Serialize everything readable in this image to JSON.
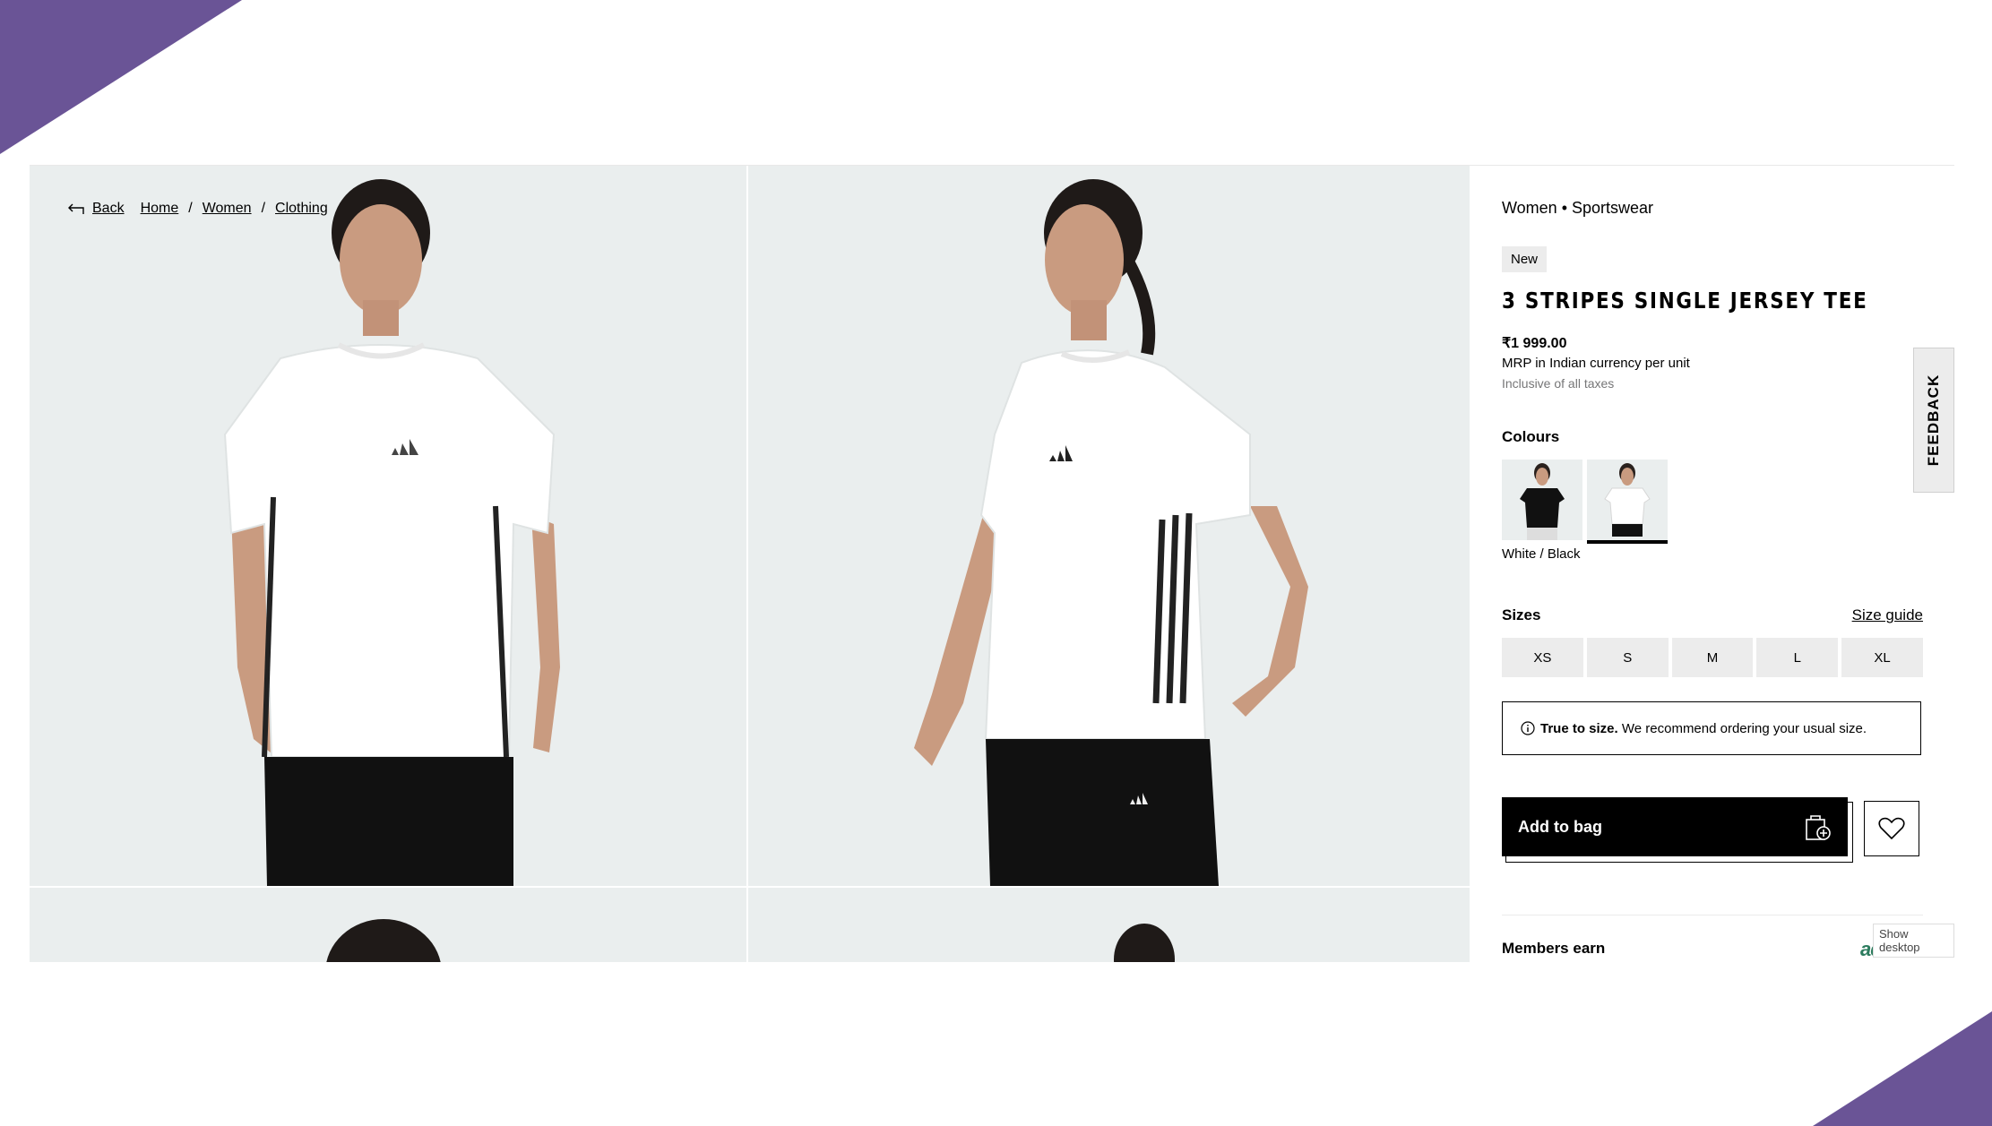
{
  "breadcrumb": {
    "back": "Back",
    "items": [
      "Home",
      "Women",
      "Clothing"
    ],
    "separator": "/"
  },
  "product": {
    "category": "Women • Sportswear",
    "badge": "New",
    "title": "3 STRIPES SINGLE JERSEY TEE",
    "price": "₹1 999.00",
    "mrp_note": "MRP in Indian currency per unit",
    "tax_note": "Inclusive of all taxes"
  },
  "colours": {
    "label": "Colours",
    "selected_name": "White / Black",
    "swatches": [
      "black-tee-swatch",
      "white-tee-swatch"
    ]
  },
  "sizes": {
    "label": "Sizes",
    "guide": "Size guide",
    "options": [
      "XS",
      "S",
      "M",
      "L",
      "XL"
    ]
  },
  "fit": {
    "bold": "True to size.",
    "text": " We recommend ordering your usual size."
  },
  "actions": {
    "add_to_bag": "Add to bag"
  },
  "members": {
    "label": "Members earn",
    "brand": "adiclub"
  },
  "feedback": "FEEDBACK",
  "tooltip": "Show desktop",
  "colors": {
    "accent_corner": "#6a5496",
    "image_bg": "#eaeeee",
    "button_black": "#000000",
    "adiclub_green": "#2c7c5e"
  }
}
